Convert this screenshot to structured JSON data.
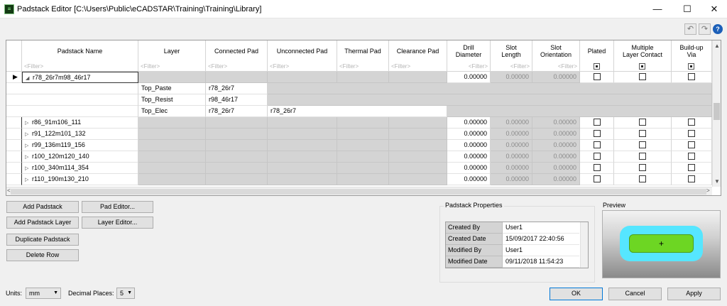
{
  "window": {
    "title": "Padstack Editor [C:\\Users\\Public\\eCADSTAR\\Training\\Training\\Library]",
    "icon_glyph": "≡",
    "minimize_glyph": "—",
    "maximize_glyph": "☐",
    "close_glyph": "✕"
  },
  "toolbar": {
    "undo_glyph": "↶",
    "redo_glyph": "↷",
    "help_glyph": "?"
  },
  "grid": {
    "columns": {
      "name": "Padstack Name",
      "layer": "Layer",
      "connected": "Connected Pad",
      "unconnected": "Unconnected Pad",
      "thermal": "Thermal Pad",
      "clearance": "Clearance Pad",
      "drill_1": "Drill",
      "drill_2": "Diameter",
      "slotlen_1": "Slot",
      "slotlen_2": "Length",
      "sloto_1": "Slot",
      "sloto_2": "Orientation",
      "plated": "Plated",
      "mlc_1": "Multiple",
      "mlc_2": "Layer Contact",
      "buildup_1": "Build-up",
      "buildup_2": "Via"
    },
    "filter_placeholder": "<Filter>",
    "current_row_marker": "▶",
    "expanded_glyph": "◢",
    "collapsed_glyph": "▷",
    "expanded": {
      "name": "r78_26r7m98_46r17",
      "drill": "0.00000",
      "slot_length": "0.00000",
      "slot_orientation": "0.00000",
      "layers": [
        {
          "layer": "Top_Paste",
          "connected": "r78_26r7",
          "unconnected": ""
        },
        {
          "layer": "Top_Resist",
          "connected": "r98_46r17",
          "unconnected": ""
        },
        {
          "layer": "Top_Elec",
          "connected": "r78_26r7",
          "unconnected": "r78_26r7"
        }
      ]
    },
    "rows": [
      {
        "name": "r86_91m106_111",
        "drill": "0.00000",
        "slot_length": "0.00000",
        "slot_orientation": "0.00000"
      },
      {
        "name": "r91_122m101_132",
        "drill": "0.00000",
        "slot_length": "0.00000",
        "slot_orientation": "0.00000"
      },
      {
        "name": "r99_136m119_156",
        "drill": "0.00000",
        "slot_length": "0.00000",
        "slot_orientation": "0.00000"
      },
      {
        "name": "r100_120m120_140",
        "drill": "0.00000",
        "slot_length": "0.00000",
        "slot_orientation": "0.00000"
      },
      {
        "name": "r100_340m114_354",
        "drill": "0.00000",
        "slot_length": "0.00000",
        "slot_orientation": "0.00000"
      },
      {
        "name": "r110_190m130_210",
        "drill": "0.00000",
        "slot_length": "0.00000",
        "slot_orientation": "0.00000"
      }
    ],
    "scroll_left_glyph": "<",
    "scroll_right_glyph": ">",
    "scroll_up_glyph": "▲",
    "scroll_down_glyph": "▼"
  },
  "buttons": {
    "add_padstack": "Add Padstack",
    "pad_editor": "Pad Editor...",
    "add_padstack_layer": "Add Padstack Layer",
    "layer_editor": "Layer Editor...",
    "duplicate_padstack": "Duplicate Padstack",
    "delete_row": "Delete Row",
    "ok": "OK",
    "cancel": "Cancel",
    "apply": "Apply"
  },
  "properties": {
    "title": "Padstack Properties",
    "rows": [
      {
        "key": "Created By",
        "value": "User1"
      },
      {
        "key": "Created Date",
        "value": "15/09/2017 22:40:56"
      },
      {
        "key": "Modified By",
        "value": "User1"
      },
      {
        "key": "Modified Date",
        "value": "09/11/2018 11:54:23"
      }
    ]
  },
  "preview": {
    "title": "Preview",
    "origin_glyph": "+",
    "annular_color": "#56e6ff",
    "pad_color": "#6dd623"
  },
  "units": {
    "label": "Units:",
    "value": "mm"
  },
  "decimal": {
    "label": "Decimal Places:",
    "value": "5"
  },
  "dropdown_glyph": "▼"
}
